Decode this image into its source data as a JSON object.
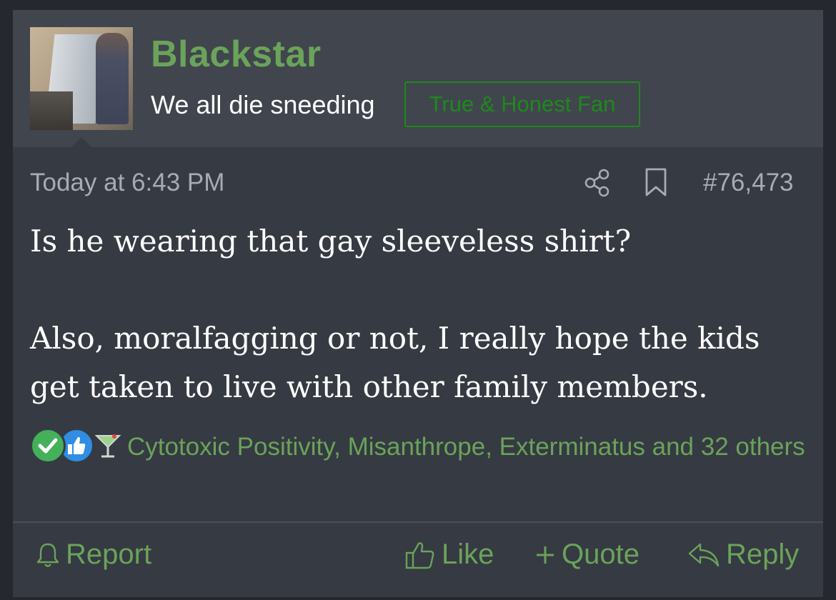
{
  "post": {
    "username": "Blackstar",
    "user_title": "We all die sneeding",
    "banner": "True & Honest Fan",
    "timestamp": "Today at 6:43 PM",
    "post_number": "#76,473",
    "message": {
      "line1": "Is he wearing that gay sleeveless shirt?",
      "line2": "Also, moralfagging or not, I really hope the kids get taken to live with other family members."
    },
    "reactions": {
      "icons": [
        "check-icon",
        "thumbs-up-icon",
        "cocktail-icon"
      ],
      "text": "Cytotoxic Positivity, Misanthrope, Exterminatus and 32 others"
    },
    "actions": {
      "report": "Report",
      "like": "Like",
      "quote": "Quote",
      "reply": "Reply"
    }
  },
  "colors": {
    "accent_green": "#6aa35a",
    "banner_green": "#1c8a1c",
    "background": "#363a42",
    "header_background": "#41454d"
  }
}
